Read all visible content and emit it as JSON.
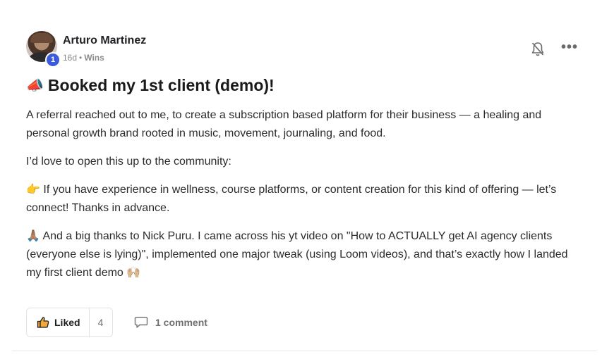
{
  "post": {
    "author": "Arturo Martinez",
    "level": "1",
    "time_ago": "16d",
    "separator": "•",
    "category": "Wins",
    "title_emoji": "📣",
    "title": "Booked my 1st client (demo)!",
    "paragraphs": {
      "p1": "A referral reached out to me, to create a subscription based platform for their business — a healing and personal growth brand rooted in music, movement, journaling, and food.",
      "p2": "I’d love to open this up to the community:",
      "p3_emoji": "👉",
      "p3": "If you have experience in wellness, course platforms, or content creation for this kind of offering — let’s connect! Thanks in advance.",
      "p4_emoji": "🙏🏽",
      "p4": "And a big thanks to Nick Puru. I came across his yt video on \"How to ACTUALLY get AI agency clients (everyone else is lying)\", implemented one major tweak (using Loom videos), and that’s exactly how I landed my first client demo",
      "p4_end_emoji": "🙌🏼"
    },
    "actions": {
      "like_label": "Liked",
      "like_count": "4",
      "comment_label": "1 comment"
    },
    "icons": {
      "bell": "bell-muted-icon",
      "more": "more-horizontal-icon",
      "like": "thumbs-up-icon",
      "comment": "comment-icon"
    }
  }
}
